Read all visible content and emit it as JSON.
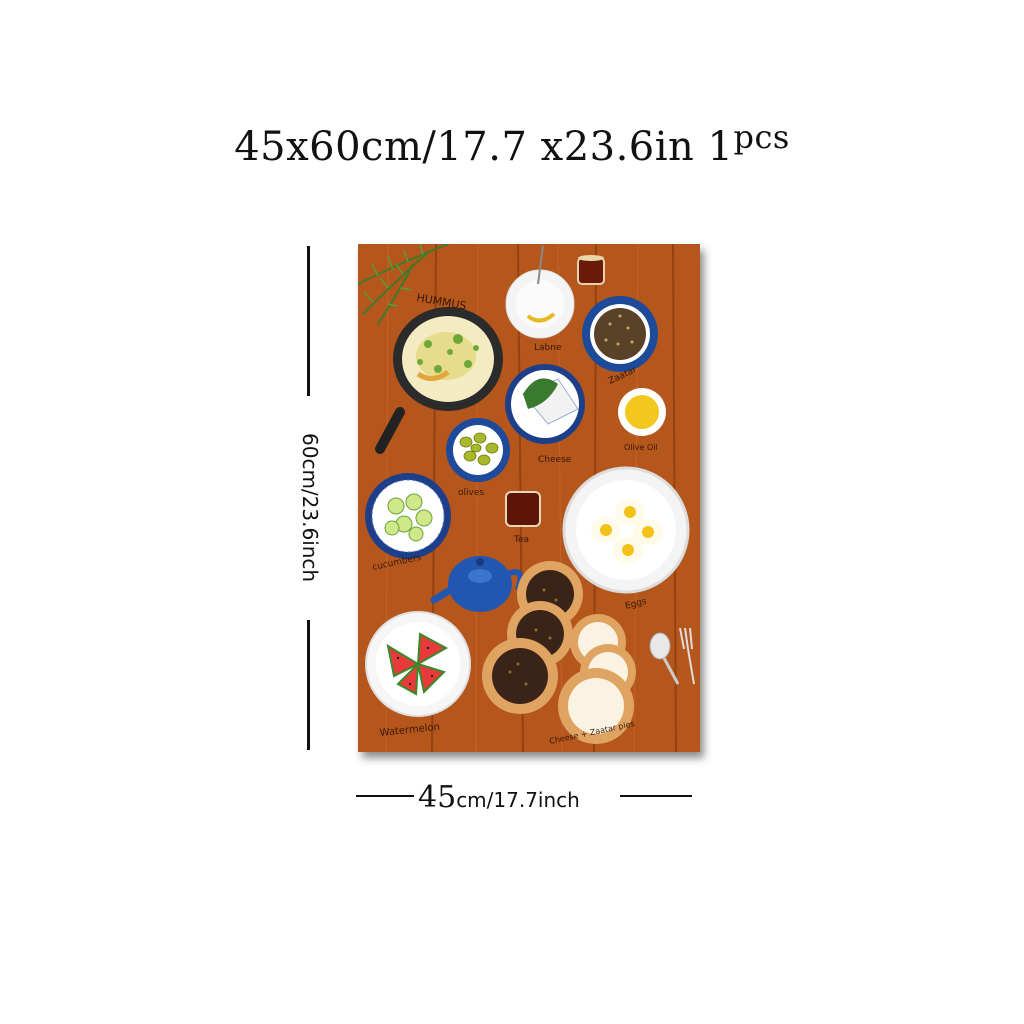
{
  "title": {
    "dimensions": "45x60cm/17.7 x23.6in",
    "count": "1",
    "unit": "pcs"
  },
  "height_label": "60cm/23.6inch",
  "width_label": {
    "value": "45",
    "rest": "cm/17.7inch"
  },
  "poster_labels": {
    "hummus": "HUMMUS",
    "labne": "Labne",
    "zaatar": "Zaatar",
    "cheese": "Cheese",
    "olive_oil": "Olive Oil",
    "olives": "olives",
    "tea": "Tea",
    "cucumbers": "cucumbers",
    "eggs": "Eggs",
    "watermelon": "Watermelon",
    "cheese_zaatar_pies": "Cheese + Zaatar pies"
  },
  "colors": {
    "table_wood": "#b5561c",
    "text": "#111111"
  }
}
